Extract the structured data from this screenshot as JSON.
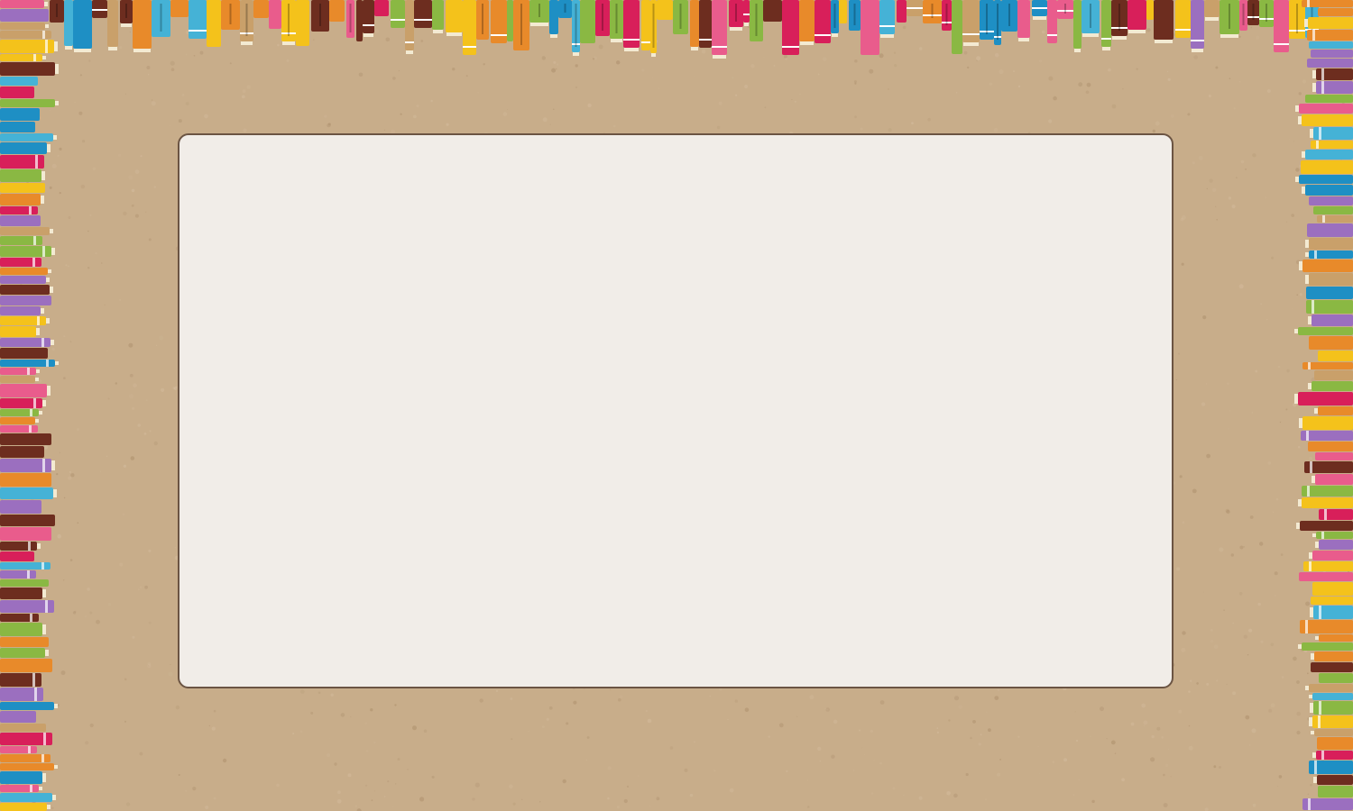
{
  "background": {
    "paper_color": "#c8ad8a",
    "speckle_color": "#a98c69"
  },
  "book_border": {
    "spine_colors": [
      "#f4c21b",
      "#d81f5a",
      "#9b6fbf",
      "#45b2d6",
      "#e88a2a",
      "#6d2d1f",
      "#8ab843",
      "#c9a06a",
      "#e95c8c",
      "#1e8fc4"
    ],
    "page_color": "#f3ead2"
  },
  "content_panel": {
    "fill": "#f1ede8",
    "border": "#6b5443"
  }
}
